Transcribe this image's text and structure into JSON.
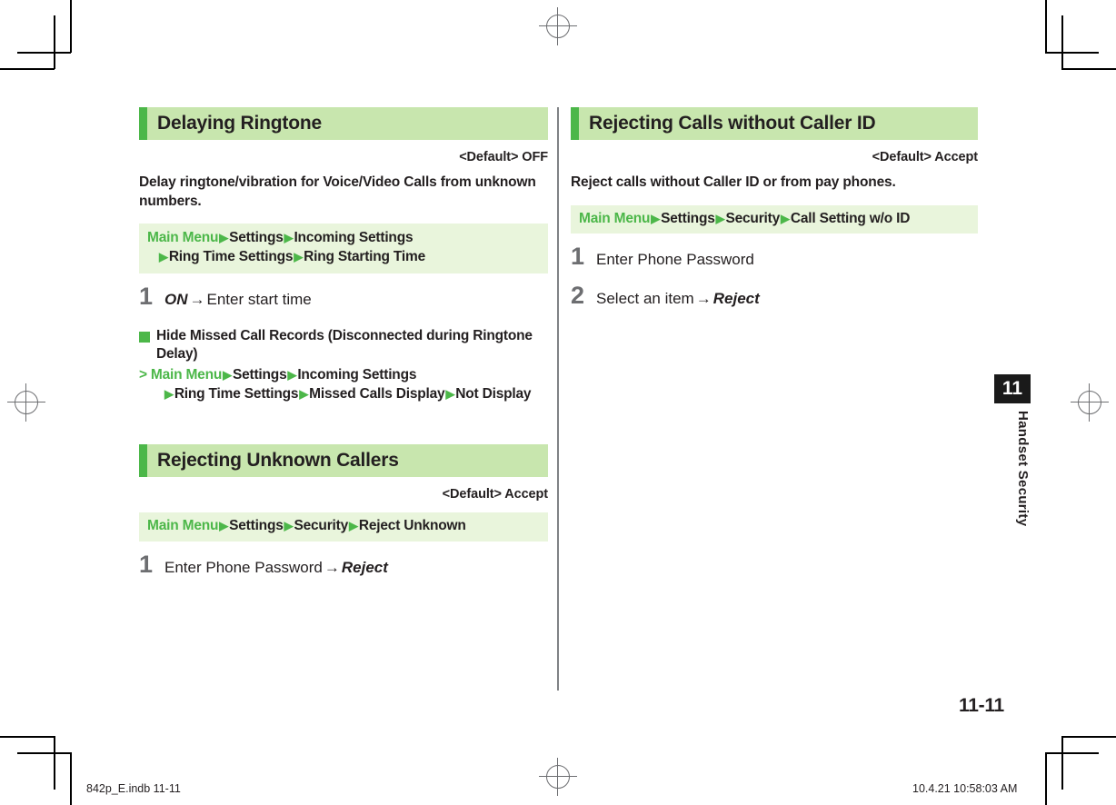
{
  "page": {
    "number": "11-11",
    "chapter_tab": "11",
    "chapter_label": "Handset Security"
  },
  "footer": {
    "left": "842p_E.indb   11-11",
    "right": "10.4.21   10:58:03 AM"
  },
  "colors": {
    "accent_green": "#4cb749",
    "heading_bg": "#c8e6ae",
    "path_bg": "#e9f5dc",
    "step_number": "#6d6e71",
    "text": "#231f20"
  },
  "left_column": {
    "sections": [
      {
        "heading": "Delaying Ringtone",
        "default_label": "<Default> OFF",
        "lead": "Delay ringtone/vibration for Voice/Video Calls from unknown numbers.",
        "path": {
          "root": "Main Menu",
          "line1_items": [
            "Settings",
            "Incoming Settings"
          ],
          "line2_items": [
            "Ring Time Settings",
            "Ring Starting Time"
          ]
        },
        "steps": [
          {
            "num": "1",
            "emphasis": "ON",
            "arrow": "→",
            "text": "Enter start time"
          }
        ],
        "subblock": {
          "title": "Hide Missed Call Records (Disconnected during Ringtone Delay)",
          "marker": ">",
          "path": {
            "root": "Main Menu",
            "line1_items": [
              "Settings",
              "Incoming Settings"
            ],
            "line2_items": [
              "Ring Time Settings",
              "Missed Calls Display",
              "Not Display"
            ]
          }
        }
      },
      {
        "heading": "Rejecting Unknown Callers",
        "default_label": "<Default> Accept",
        "path": {
          "root": "Main Menu",
          "line1_items": [
            "Settings",
            "Security",
            "Reject Unknown"
          ]
        },
        "steps": [
          {
            "num": "1",
            "text": "Enter Phone Password",
            "arrow": "→",
            "emphasis_after": "Reject"
          }
        ]
      }
    ]
  },
  "right_column": {
    "sections": [
      {
        "heading": "Rejecting Calls without Caller ID",
        "default_label": "<Default> Accept",
        "lead": "Reject calls without Caller ID or from pay phones.",
        "path": {
          "root": "Main Menu",
          "line1_items": [
            "Settings",
            "Security",
            "Call Setting w/o ID"
          ]
        },
        "steps": [
          {
            "num": "1",
            "text": "Enter Phone Password"
          },
          {
            "num": "2",
            "text": "Select an item",
            "arrow": "→",
            "emphasis_after": "Reject"
          }
        ]
      }
    ]
  }
}
